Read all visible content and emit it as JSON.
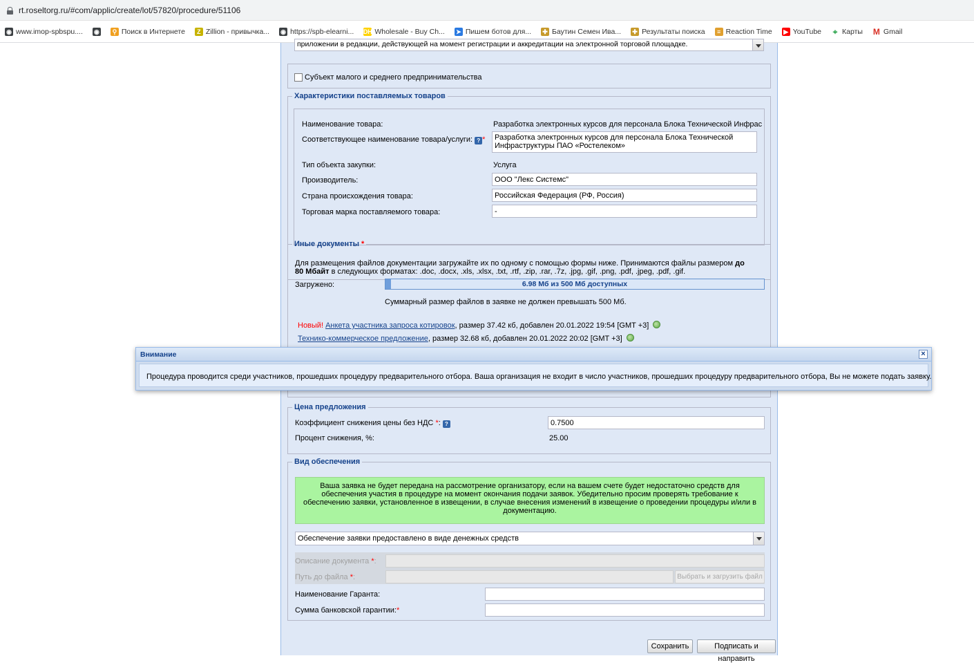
{
  "browser": {
    "url": "rt.roseltorg.ru/#com/applic/create/lot/57820/procedure/51106",
    "bookmarks": [
      {
        "label": "www.imop-spbspu....",
        "icon": "globe-icon",
        "color": "#3c4043"
      },
      {
        "label": "",
        "icon": "globe-icon",
        "color": "#3c4043"
      },
      {
        "label": "Поиск в Интернете",
        "icon": "search-icon",
        "color": "#f0a020"
      },
      {
        "label": "Zillion - привычка...",
        "icon": "zillion-icon",
        "color": "#c7b300"
      },
      {
        "label": "https://spb-elearni...",
        "icon": "globe-icon",
        "color": "#3c4043"
      },
      {
        "label": "Wholesale - Buy Ch...",
        "icon": "dh-icon",
        "color": "#ffd200"
      },
      {
        "label": "Пишем ботов для...",
        "icon": "bird-icon",
        "color": "#2a7ae2"
      },
      {
        "label": "Баутин Семен Ива...",
        "icon": "cross-icon",
        "color": "#c79a2b"
      },
      {
        "label": "Результаты поиска",
        "icon": "cross-icon",
        "color": "#c79a2b"
      },
      {
        "label": "Reaction Time",
        "icon": "reaction-icon",
        "color": "#e0a030"
      },
      {
        "label": "YouTube",
        "icon": "youtube-icon",
        "color": "#ff0000"
      },
      {
        "label": "Карты",
        "icon": "maps-icon",
        "color": "#34a853"
      },
      {
        "label": "Gmail",
        "icon": "gmail-icon",
        "color": "#d93025"
      }
    ]
  },
  "form": {
    "top_select_text": "приложении в редакции, действующей на момент регистрации и аккредитации на электронной торговой площадке.",
    "sme_checkbox_label": "Субъект малого и среднего предпринимательства",
    "goods": {
      "legend": "Характеристики поставляемых товаров",
      "name_label": "Наименование товара:",
      "name_value": "Разработка электронных курсов для персонала Блока Технической Инфрас",
      "match_label": "Соответствующее наименование товара/услуги:",
      "match_value_line1": "Разработка электронных курсов для персонала Блока Технической",
      "match_value_line2": "Инфраструктуры ПАО «Ростелеком»",
      "type_label": "Тип объекта закупки:",
      "type_value": "Услуга",
      "manufacturer_label": "Производитель:",
      "manufacturer_value": "ООО \"Лекс Системс\"",
      "country_label": "Страна происхождения товара:",
      "country_value": "Российская Федерация (РФ, Россия)",
      "brand_label": "Торговая марка поставляемого товара:",
      "brand_value": "-"
    },
    "docs": {
      "legend": "Иные документы",
      "info_line1_start": "Для размещения файлов документации загружайте их по одному с помощью формы ниже. Принимаются файлы размером ",
      "info_line1_bold": "до",
      "info_line2_bold": "80 Мбайт",
      "info_line2_rest": " в следующих форматах: .doc, .docx, .xls, .xlsx, .txt, .rtf, .zip, .rar, .7z, .jpg, .gif, .png, .pdf, .jpeg, .pdf, .gif.",
      "uploaded_label": "Загружено:",
      "progress_text": "6.98 Мб из 500 Мб доступных",
      "progress_fraction": 0.014,
      "limit_note": "Суммарный размер файлов в заявке не должен превышать 500 Мб.",
      "files": [
        {
          "new": "Новый!",
          "name": "Анкета участника запроса котировок",
          "info": ", размер 37.42 кб, добавлен 20.01.2022 19:54 [GMT +3]"
        },
        {
          "new": "",
          "name": "Технико-коммерческое предложение",
          "info": ", размер 32.68 кб, добавлен 20.01.2022 20:02 [GMT +3]"
        }
      ]
    },
    "price": {
      "legend": "Цена предложения",
      "coef_label": "Коэффициент снижения цены без НДС",
      "coef_value": "0.7500",
      "percent_label": "Процент снижения, %:",
      "percent_value": "25.00"
    },
    "security": {
      "legend": "Вид обеспечения",
      "notice": "Ваша заявка не будет передана на рассмотрение организатору, если на вашем счете будет недостаточно средств для обеспечения участия в процедуре на момент окончания подачи заявок. Убедительно просим проверять требование к обеспечению заявки, установленное в извещении, в случае внесения изменений в извещение о проведении процедуры и/или в документацию.",
      "select_value": "Обеспечение заявки предоставлено в виде денежных средств",
      "doc_desc_label": "Описание документа",
      "file_path_label": "Путь до файла",
      "upload_button": "Выбрать и загрузить файл",
      "guarantor_label": "Наименование Гаранта:",
      "guarantee_sum_label": "Сумма банковской гарантии:"
    },
    "buttons": {
      "save": "Сохранить",
      "sign_send": "Подписать и направить"
    }
  },
  "modal": {
    "title": "Внимание",
    "close": "×",
    "text": "Процедура проводится среди участников, прошедших процедуру предварительного отбора. Ваша организация не входит в число участников, прошедших процедуру предварительного отбора, Вы не можете подать заявку."
  }
}
